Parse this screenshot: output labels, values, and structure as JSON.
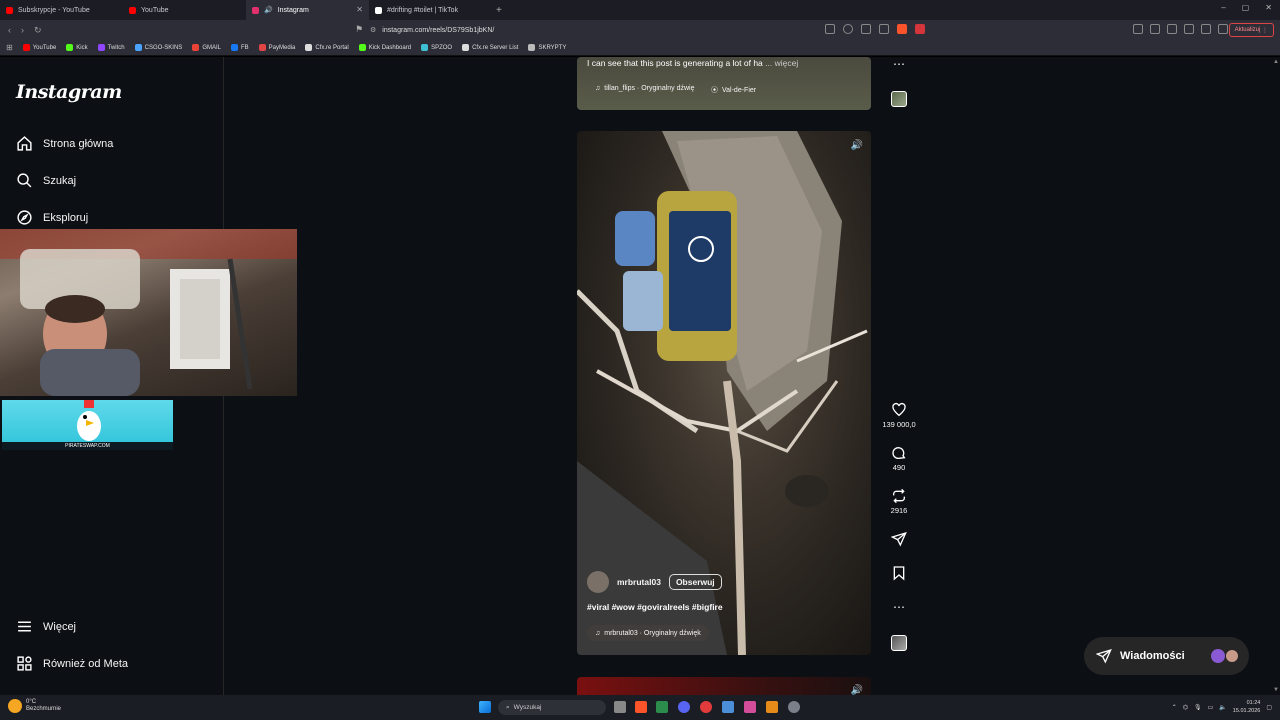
{
  "tabs": [
    {
      "label": "Subskrypcje - YouTube",
      "color": "#ff0000",
      "active": false
    },
    {
      "label": "YouTube",
      "color": "#ff0000",
      "active": false
    },
    {
      "label": "Instagram",
      "color": "#e1306c",
      "active": true
    },
    {
      "label": "#drifting #toilet | TikTok",
      "color": "#ffffff",
      "active": false
    }
  ],
  "window_controls": {
    "minimize": "–",
    "maximize": "▢",
    "close": "✕"
  },
  "address_bar": {
    "url": "instagram.com/reels/DS79Sb1jbKN/"
  },
  "update_button": "Aktualizuj",
  "bookmarks": [
    {
      "label": "YouTube",
      "color": "#ff0000"
    },
    {
      "label": "Kick",
      "color": "#53fc18"
    },
    {
      "label": "Twitch",
      "color": "#9146ff"
    },
    {
      "label": "CSGO-SKINS",
      "color": "#4aa3ff"
    },
    {
      "label": "GMAIL",
      "color": "#ea4335"
    },
    {
      "label": "FB",
      "color": "#1877f2"
    },
    {
      "label": "PayMedia",
      "color": "#e04444"
    },
    {
      "label": "Cfx.re Portal",
      "color": "#dddddd"
    },
    {
      "label": "Kick Dashboard",
      "color": "#53fc18"
    },
    {
      "label": "SPZOO",
      "color": "#3ec1d3"
    },
    {
      "label": "Cfx.re Server List",
      "color": "#dddddd"
    },
    {
      "label": "SKRYPTY",
      "color": "#bbbbbb"
    }
  ],
  "instagram": {
    "logo": "Instagram",
    "nav": {
      "home": "Strona główna",
      "search": "Szukaj",
      "explore": "Eksploruj",
      "more": "Więcej",
      "meta": "Również od Meta"
    },
    "top_reel": {
      "caption": "I can see that this post is generating a lot of ha",
      "more_label": "... więcej",
      "audio": "tillan_flips · Oryginalny dźwię",
      "location": "Val-de-Fier"
    },
    "main_reel": {
      "username": "mrbrutal03",
      "follow_label": "Obserwuj",
      "hashtags": "#viral #wow #goviralreels #bigfire",
      "audio": "mrbrutal03 · Oryginalny dźwięk",
      "likes": "139 000,0",
      "comments": "490",
      "reposts": "2916"
    },
    "messages_label": "Wiadomości"
  },
  "ad_banner": {
    "label": "PIRATESWAP.COM"
  },
  "taskbar": {
    "weather_temp": "0°C",
    "weather_desc": "Bezchmurnie",
    "search_placeholder": "Wyszukaj",
    "time": "01:24",
    "date": "15.01.2026"
  }
}
